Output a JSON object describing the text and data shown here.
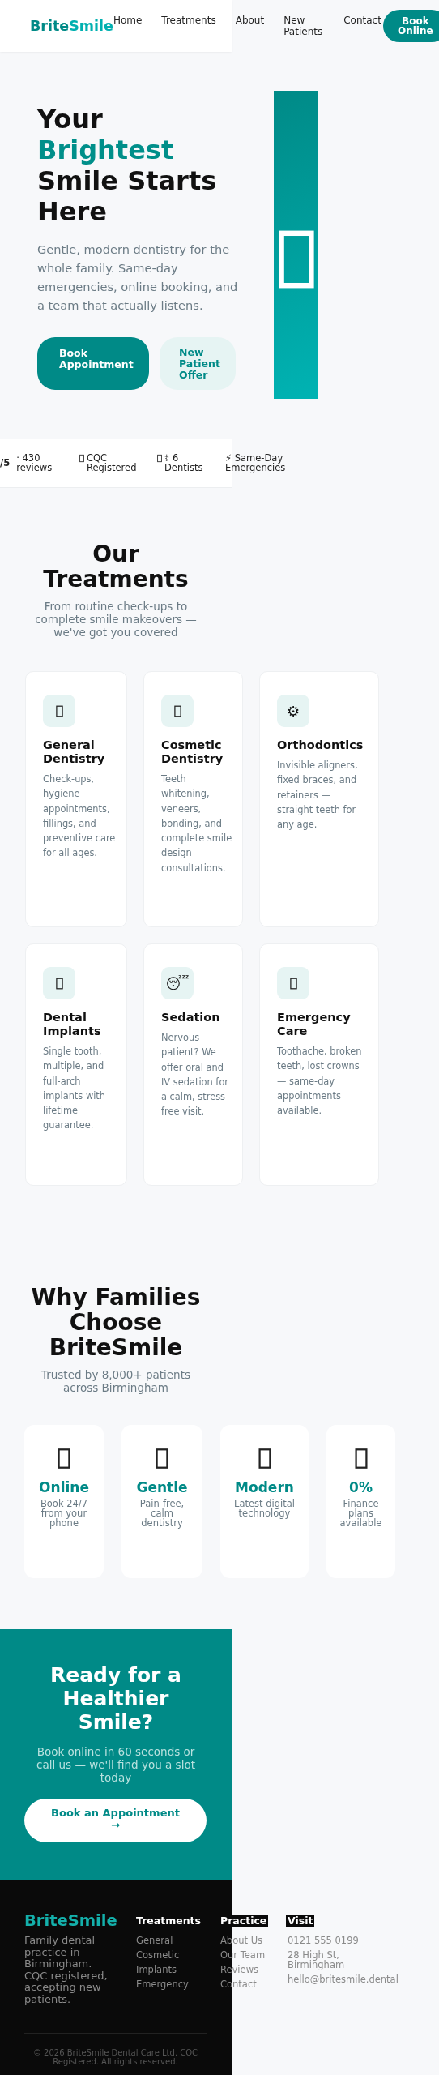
{
  "header": {
    "logo": {
      "part1": "Brite",
      "part2": "Smile"
    },
    "nav": [
      {
        "label": "Home"
      },
      {
        "label": "Treatments"
      },
      {
        "label": "About"
      },
      {
        "label": "New Patients"
      },
      {
        "label": "Contact"
      }
    ],
    "cta": "Book Online"
  },
  "hero": {
    "title_before": "Your",
    "title_highlight": "Brightest",
    "title_after": "Smile Starts Here",
    "subtitle": "Gentle, modern dentistry for the whole family. Same-day emergencies, online booking, and a team that actually listens.",
    "buttons": [
      {
        "label": "Book Appointment",
        "kind": "primary"
      },
      {
        "label": "New Patient Offer",
        "kind": "secondary"
      }
    ]
  },
  "stats": [
    {
      "kind": "rating",
      "value": "/5",
      "text": "· 430 reviews"
    },
    {
      "kind": "icon",
      "text": "CQC Registered"
    },
    {
      "kind": "icon",
      "text": "⚕ 6 Dentists"
    },
    {
      "kind": "plain",
      "text": "⚡ Same-Day Emergencies"
    }
  ],
  "treatments": {
    "title": "Our Treatments",
    "subtitle": "From routine check-ups to complete smile makeovers — we've got you covered",
    "cards": [
      {
        "title": "General Dentistry",
        "text": "Check-ups, hygiene appointments, fillings, and preventive care for all ages."
      },
      {
        "title": "Cosmetic Dentistry",
        "text": "Teeth whitening, veneers, bonding, and complete smile design consultations."
      },
      {
        "icon": "⚙",
        "title": "Orthodontics",
        "text": "Invisible aligners, fixed braces, and retainers — straight teeth for any age."
      },
      {
        "title": "Dental Implants",
        "text": "Single tooth, multiple, and full-arch implants with lifetime guarantee."
      },
      {
        "icon": "😴",
        "title": "Sedation",
        "text": "Nervous patient? We offer oral and IV sedation for a calm, stress-free visit."
      },
      {
        "title": "Emergency Care",
        "text": "Toothache, broken teeth, lost crowns — same-day appointments available."
      }
    ]
  },
  "why": {
    "title": "Why Families Choose BriteSmile",
    "subtitle": "Trusted by 8,000+ patients across Birmingham",
    "cards": [
      {
        "title": "Online",
        "text": "Book 24/7 from your phone"
      },
      {
        "title": "Gentle",
        "text": "Pain-free, calm dentistry"
      },
      {
        "title": "Modern",
        "text": "Latest digital technology"
      },
      {
        "title": "0%",
        "text": "Finance plans available"
      }
    ]
  },
  "cta": {
    "title": "Ready for a Healthier Smile?",
    "subtitle": "Book online in 60 seconds or call us — we'll find you a slot today",
    "button": "Book an Appointment →"
  },
  "footer": {
    "logo": "BriteSmile",
    "about": "Family dental practice in Birmingham. CQC registered, accepting new patients.",
    "columns": [
      {
        "heading": "Treatments",
        "links": [
          "General",
          "Cosmetic",
          "Implants",
          "Emergency"
        ]
      },
      {
        "heading": "Practice",
        "links": [
          "About Us",
          "Our Team",
          "Reviews",
          "Contact"
        ]
      },
      {
        "heading": "Visit",
        "links": [
          "0121 555 0199",
          "28 High St, Birmingham",
          "hello@britesmile.dental"
        ]
      }
    ],
    "copyright": "© 2026 BriteSmile Dental Care Ltd. CQC Registered. All rights reserved."
  }
}
